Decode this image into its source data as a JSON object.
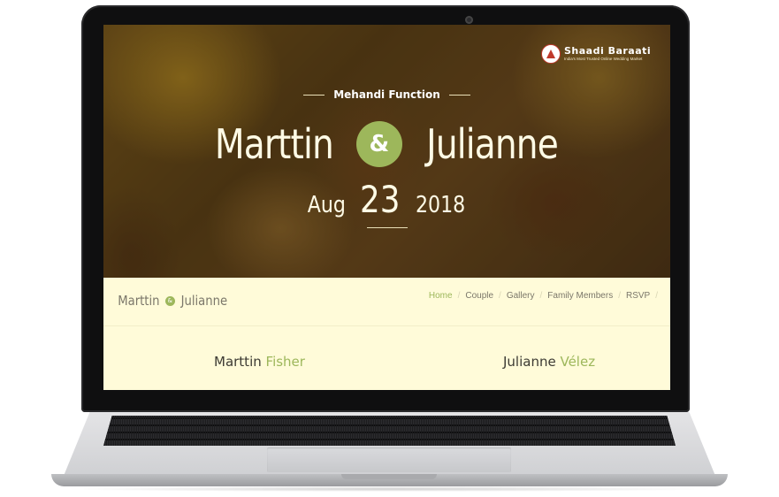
{
  "hero": {
    "brand_logo": {
      "name": "Shaadi Baraati",
      "tagline": "India's Most Trusted Online Wedding Market",
      "icon": "shaadi-baraati-logo-icon"
    },
    "event": "Mehandi Function",
    "groom_first": "Marttin",
    "ampersand": "&",
    "bride_first": "Julianne",
    "date": {
      "month": "Aug",
      "day": "23",
      "year": "2018"
    }
  },
  "navbar": {
    "brand": {
      "first": "Marttin",
      "amp": "&",
      "second": "Julianne"
    },
    "links": [
      {
        "label": "Home",
        "active": true
      },
      {
        "label": "Couple",
        "active": false
      },
      {
        "label": "Gallery",
        "active": false
      },
      {
        "label": "Family Members",
        "active": false
      },
      {
        "label": "RSVP",
        "active": false
      }
    ],
    "separator": "/"
  },
  "couple": {
    "groom": {
      "first": "Marttin",
      "last": "Fisher"
    },
    "bride": {
      "first": "Julianne",
      "last": "Vélez"
    }
  },
  "colors": {
    "accent": "#9db75b",
    "section_bg": "#fffbd9",
    "text": "#3c3a33"
  }
}
